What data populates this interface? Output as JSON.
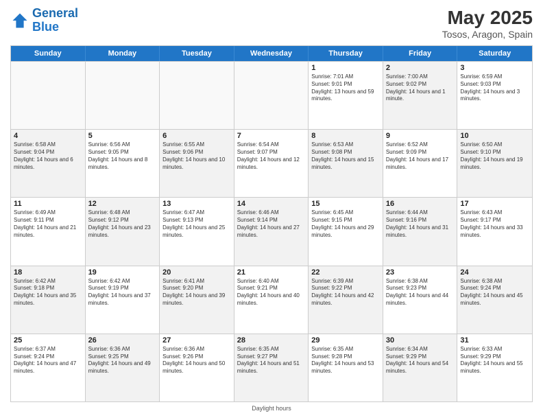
{
  "header": {
    "logo_general": "General",
    "logo_blue": "Blue",
    "title": "May 2025",
    "subtitle": "Tosos, Aragon, Spain"
  },
  "days_of_week": [
    "Sunday",
    "Monday",
    "Tuesday",
    "Wednesday",
    "Thursday",
    "Friday",
    "Saturday"
  ],
  "footer": "Daylight hours",
  "weeks": [
    [
      {
        "day": "",
        "sunrise": "",
        "sunset": "",
        "daylight": "",
        "shaded": false,
        "empty": true
      },
      {
        "day": "",
        "sunrise": "",
        "sunset": "",
        "daylight": "",
        "shaded": false,
        "empty": true
      },
      {
        "day": "",
        "sunrise": "",
        "sunset": "",
        "daylight": "",
        "shaded": false,
        "empty": true
      },
      {
        "day": "",
        "sunrise": "",
        "sunset": "",
        "daylight": "",
        "shaded": false,
        "empty": true
      },
      {
        "day": "1",
        "sunrise": "Sunrise: 7:01 AM",
        "sunset": "Sunset: 9:01 PM",
        "daylight": "Daylight: 13 hours and 59 minutes.",
        "shaded": false,
        "empty": false
      },
      {
        "day": "2",
        "sunrise": "Sunrise: 7:00 AM",
        "sunset": "Sunset: 9:02 PM",
        "daylight": "Daylight: 14 hours and 1 minute.",
        "shaded": true,
        "empty": false
      },
      {
        "day": "3",
        "sunrise": "Sunrise: 6:59 AM",
        "sunset": "Sunset: 9:03 PM",
        "daylight": "Daylight: 14 hours and 3 minutes.",
        "shaded": false,
        "empty": false
      }
    ],
    [
      {
        "day": "4",
        "sunrise": "Sunrise: 6:58 AM",
        "sunset": "Sunset: 9:04 PM",
        "daylight": "Daylight: 14 hours and 6 minutes.",
        "shaded": true,
        "empty": false
      },
      {
        "day": "5",
        "sunrise": "Sunrise: 6:56 AM",
        "sunset": "Sunset: 9:05 PM",
        "daylight": "Daylight: 14 hours and 8 minutes.",
        "shaded": false,
        "empty": false
      },
      {
        "day": "6",
        "sunrise": "Sunrise: 6:55 AM",
        "sunset": "Sunset: 9:06 PM",
        "daylight": "Daylight: 14 hours and 10 minutes.",
        "shaded": true,
        "empty": false
      },
      {
        "day": "7",
        "sunrise": "Sunrise: 6:54 AM",
        "sunset": "Sunset: 9:07 PM",
        "daylight": "Daylight: 14 hours and 12 minutes.",
        "shaded": false,
        "empty": false
      },
      {
        "day": "8",
        "sunrise": "Sunrise: 6:53 AM",
        "sunset": "Sunset: 9:08 PM",
        "daylight": "Daylight: 14 hours and 15 minutes.",
        "shaded": true,
        "empty": false
      },
      {
        "day": "9",
        "sunrise": "Sunrise: 6:52 AM",
        "sunset": "Sunset: 9:09 PM",
        "daylight": "Daylight: 14 hours and 17 minutes.",
        "shaded": false,
        "empty": false
      },
      {
        "day": "10",
        "sunrise": "Sunrise: 6:50 AM",
        "sunset": "Sunset: 9:10 PM",
        "daylight": "Daylight: 14 hours and 19 minutes.",
        "shaded": true,
        "empty": false
      }
    ],
    [
      {
        "day": "11",
        "sunrise": "Sunrise: 6:49 AM",
        "sunset": "Sunset: 9:11 PM",
        "daylight": "Daylight: 14 hours and 21 minutes.",
        "shaded": false,
        "empty": false
      },
      {
        "day": "12",
        "sunrise": "Sunrise: 6:48 AM",
        "sunset": "Sunset: 9:12 PM",
        "daylight": "Daylight: 14 hours and 23 minutes.",
        "shaded": true,
        "empty": false
      },
      {
        "day": "13",
        "sunrise": "Sunrise: 6:47 AM",
        "sunset": "Sunset: 9:13 PM",
        "daylight": "Daylight: 14 hours and 25 minutes.",
        "shaded": false,
        "empty": false
      },
      {
        "day": "14",
        "sunrise": "Sunrise: 6:46 AM",
        "sunset": "Sunset: 9:14 PM",
        "daylight": "Daylight: 14 hours and 27 minutes.",
        "shaded": true,
        "empty": false
      },
      {
        "day": "15",
        "sunrise": "Sunrise: 6:45 AM",
        "sunset": "Sunset: 9:15 PM",
        "daylight": "Daylight: 14 hours and 29 minutes.",
        "shaded": false,
        "empty": false
      },
      {
        "day": "16",
        "sunrise": "Sunrise: 6:44 AM",
        "sunset": "Sunset: 9:16 PM",
        "daylight": "Daylight: 14 hours and 31 minutes.",
        "shaded": true,
        "empty": false
      },
      {
        "day": "17",
        "sunrise": "Sunrise: 6:43 AM",
        "sunset": "Sunset: 9:17 PM",
        "daylight": "Daylight: 14 hours and 33 minutes.",
        "shaded": false,
        "empty": false
      }
    ],
    [
      {
        "day": "18",
        "sunrise": "Sunrise: 6:42 AM",
        "sunset": "Sunset: 9:18 PM",
        "daylight": "Daylight: 14 hours and 35 minutes.",
        "shaded": true,
        "empty": false
      },
      {
        "day": "19",
        "sunrise": "Sunrise: 6:42 AM",
        "sunset": "Sunset: 9:19 PM",
        "daylight": "Daylight: 14 hours and 37 minutes.",
        "shaded": false,
        "empty": false
      },
      {
        "day": "20",
        "sunrise": "Sunrise: 6:41 AM",
        "sunset": "Sunset: 9:20 PM",
        "daylight": "Daylight: 14 hours and 39 minutes.",
        "shaded": true,
        "empty": false
      },
      {
        "day": "21",
        "sunrise": "Sunrise: 6:40 AM",
        "sunset": "Sunset: 9:21 PM",
        "daylight": "Daylight: 14 hours and 40 minutes.",
        "shaded": false,
        "empty": false
      },
      {
        "day": "22",
        "sunrise": "Sunrise: 6:39 AM",
        "sunset": "Sunset: 9:22 PM",
        "daylight": "Daylight: 14 hours and 42 minutes.",
        "shaded": true,
        "empty": false
      },
      {
        "day": "23",
        "sunrise": "Sunrise: 6:38 AM",
        "sunset": "Sunset: 9:23 PM",
        "daylight": "Daylight: 14 hours and 44 minutes.",
        "shaded": false,
        "empty": false
      },
      {
        "day": "24",
        "sunrise": "Sunrise: 6:38 AM",
        "sunset": "Sunset: 9:24 PM",
        "daylight": "Daylight: 14 hours and 45 minutes.",
        "shaded": true,
        "empty": false
      }
    ],
    [
      {
        "day": "25",
        "sunrise": "Sunrise: 6:37 AM",
        "sunset": "Sunset: 9:24 PM",
        "daylight": "Daylight: 14 hours and 47 minutes.",
        "shaded": false,
        "empty": false
      },
      {
        "day": "26",
        "sunrise": "Sunrise: 6:36 AM",
        "sunset": "Sunset: 9:25 PM",
        "daylight": "Daylight: 14 hours and 49 minutes.",
        "shaded": true,
        "empty": false
      },
      {
        "day": "27",
        "sunrise": "Sunrise: 6:36 AM",
        "sunset": "Sunset: 9:26 PM",
        "daylight": "Daylight: 14 hours and 50 minutes.",
        "shaded": false,
        "empty": false
      },
      {
        "day": "28",
        "sunrise": "Sunrise: 6:35 AM",
        "sunset": "Sunset: 9:27 PM",
        "daylight": "Daylight: 14 hours and 51 minutes.",
        "shaded": true,
        "empty": false
      },
      {
        "day": "29",
        "sunrise": "Sunrise: 6:35 AM",
        "sunset": "Sunset: 9:28 PM",
        "daylight": "Daylight: 14 hours and 53 minutes.",
        "shaded": false,
        "empty": false
      },
      {
        "day": "30",
        "sunrise": "Sunrise: 6:34 AM",
        "sunset": "Sunset: 9:29 PM",
        "daylight": "Daylight: 14 hours and 54 minutes.",
        "shaded": true,
        "empty": false
      },
      {
        "day": "31",
        "sunrise": "Sunrise: 6:33 AM",
        "sunset": "Sunset: 9:29 PM",
        "daylight": "Daylight: 14 hours and 55 minutes.",
        "shaded": false,
        "empty": false
      }
    ]
  ]
}
